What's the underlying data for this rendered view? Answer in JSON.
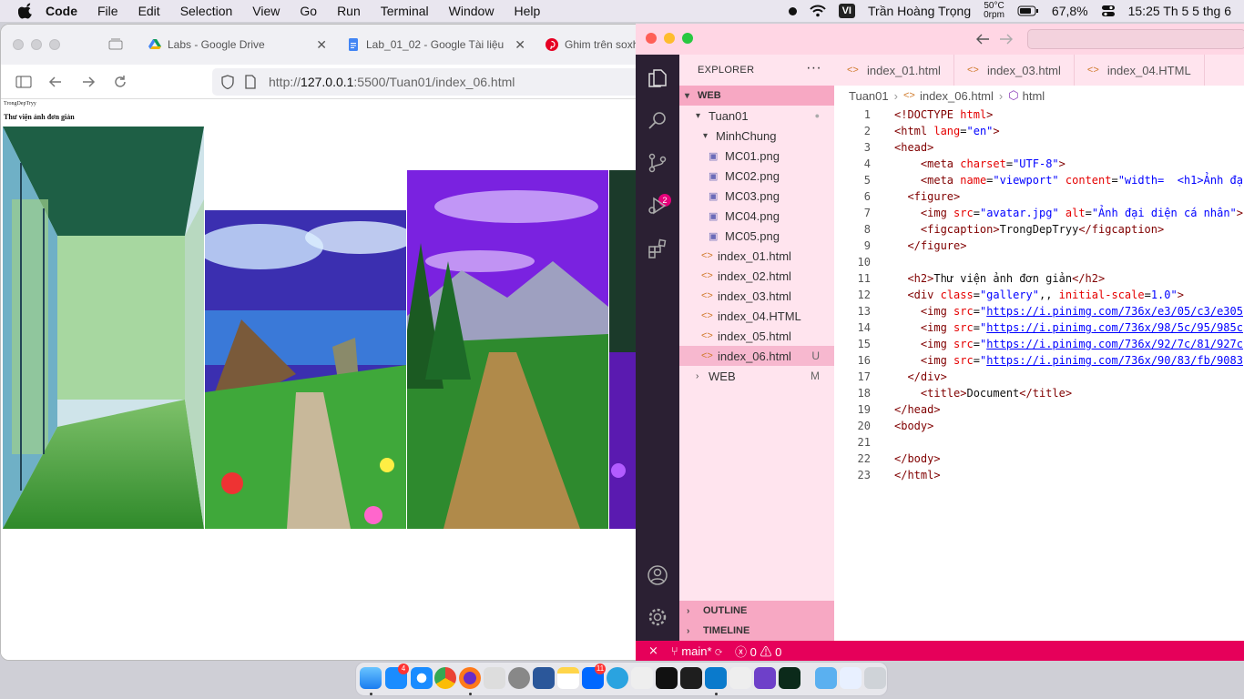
{
  "menubar": {
    "app_name": "Code",
    "items": [
      "File",
      "Edit",
      "Selection",
      "View",
      "Go",
      "Run",
      "Terminal",
      "Window",
      "Help"
    ],
    "input_source": "VI",
    "user": "Trần Hoàng Trọng",
    "temp_top": "50°C",
    "temp_bottom": "0rpm",
    "battery": "67,8%",
    "clock": "15:25 Th 5 5 thg 6"
  },
  "browser": {
    "tabs": [
      {
        "label": "Labs - Google Drive",
        "close": "✕"
      },
      {
        "label": "Lab_01_02 - Google Tài liệu",
        "close": "✕"
      },
      {
        "label": "Ghim trên soxh"
      }
    ],
    "url_prefix": "http://",
    "url_host": "127.0.0.1",
    "url_rest": ":5500/Tuan01/index_06.html",
    "page": {
      "caption": "TrongDepTryy",
      "heading": "Thư viện ảnh đơn giản"
    }
  },
  "vscode": {
    "explorer_title": "EXPLORER",
    "explorer_more": "···",
    "workspace": "WEB",
    "tree": [
      {
        "label": "Tuan01",
        "kind": "folder",
        "status": "●"
      },
      {
        "label": "MinhChung",
        "kind": "folder"
      },
      {
        "label": "MC01.png",
        "kind": "png"
      },
      {
        "label": "MC02.png",
        "kind": "png"
      },
      {
        "label": "MC03.png",
        "kind": "png"
      },
      {
        "label": "MC04.png",
        "kind": "png"
      },
      {
        "label": "MC05.png",
        "kind": "png"
      },
      {
        "label": "index_01.html",
        "kind": "html"
      },
      {
        "label": "index_02.html",
        "kind": "html"
      },
      {
        "label": "index_03.html",
        "kind": "html"
      },
      {
        "label": "index_04.HTML",
        "kind": "html"
      },
      {
        "label": "index_05.html",
        "kind": "html"
      },
      {
        "label": "index_06.html",
        "kind": "html",
        "status": "U"
      },
      {
        "label": "WEB",
        "kind": "folder",
        "status": "M"
      }
    ],
    "outline": "OUTLINE",
    "timeline": "TIMELINE",
    "source_control_badge": "2",
    "editor_tabs": [
      "index_01.html",
      "index_03.html",
      "index_04.HTML"
    ],
    "breadcrumb": [
      "Tuan01",
      "index_06.html",
      "html"
    ],
    "status": {
      "branch": "main*",
      "errors": "0",
      "warnings": "0"
    }
  },
  "dock": {
    "appstore_badge": "4",
    "zalo_badge": "11"
  },
  "colors": {
    "vscode_title": "#ffd6e4",
    "vscode_sidebar": "#ffe4ee",
    "vscode_activity": "#2b2033",
    "vscode_status": "#e6005a",
    "section_header": "#f7a8c3"
  }
}
